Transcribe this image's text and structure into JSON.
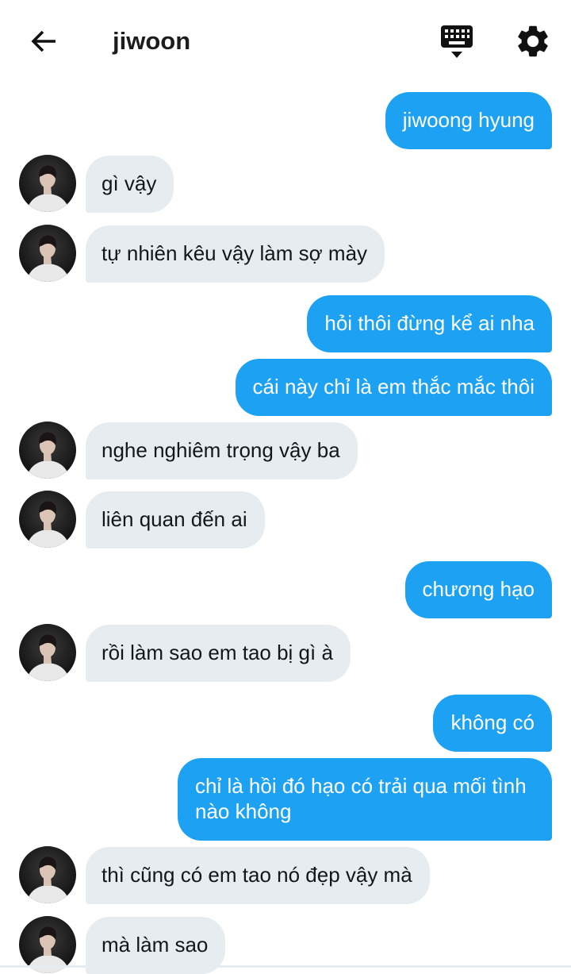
{
  "header": {
    "title": "jiwoon",
    "back_icon": "arrow-left-icon",
    "keyboard_icon": "keyboard-icon",
    "settings_icon": "gear-icon"
  },
  "colors": {
    "outgoing_bubble": "#1da1f2",
    "incoming_bubble": "#e6ecf0",
    "background": "#ffffff"
  },
  "messages": [
    {
      "side": "out",
      "text": "jiwoong hyung"
    },
    {
      "side": "in",
      "text": "gì vậy"
    },
    {
      "side": "in",
      "text": "tự nhiên kêu vậy làm sợ mày"
    },
    {
      "side": "out",
      "text": "hỏi thôi đừng kể ai nha"
    },
    {
      "side": "out",
      "text": "cái này chỉ là em thắc mắc thôi"
    },
    {
      "side": "in",
      "text": "nghe nghiêm trọng vậy ba"
    },
    {
      "side": "in",
      "text": "liên quan đến ai"
    },
    {
      "side": "out",
      "text": "chương hạo"
    },
    {
      "side": "in",
      "text": "rồi làm sao em tao bị gì à"
    },
    {
      "side": "out",
      "text": "không có"
    },
    {
      "side": "out",
      "text": "chỉ là hồi đó hạo có trải qua mối tình nào không"
    },
    {
      "side": "in",
      "text": "thì cũng có em tao nó đẹp vậy mà"
    },
    {
      "side": "in",
      "text": "mà làm sao"
    }
  ]
}
